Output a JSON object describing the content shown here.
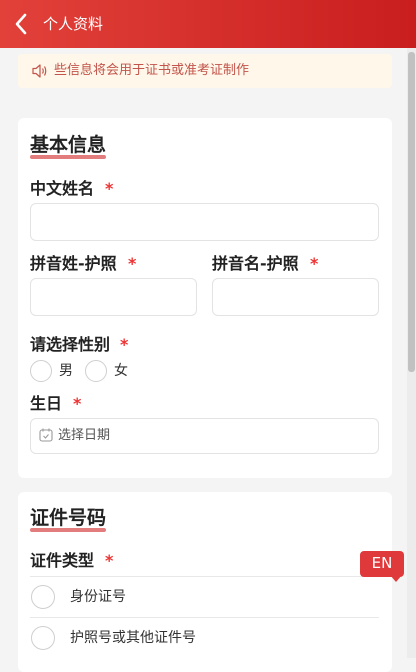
{
  "header": {
    "title": "个人资料",
    "icon": "chevron-left-icon"
  },
  "notice": {
    "icon": "speaker-icon",
    "text": "些信息将会用于证书或准考证制作"
  },
  "basic_info": {
    "title": "基本信息",
    "chinese_name": {
      "label": "中文姓名",
      "required": "*",
      "value": ""
    },
    "pinyin_surname": {
      "label": "拼音姓-护照",
      "required": "*",
      "value": ""
    },
    "pinyin_given": {
      "label": "拼音名-护照",
      "required": "*",
      "value": ""
    },
    "gender": {
      "label": "请选择性别",
      "required": "*",
      "options": [
        "男",
        "女"
      ]
    },
    "birthday": {
      "label": "生日",
      "required": "*",
      "placeholder": "选择日期",
      "icon": "calendar-icon"
    }
  },
  "id_info": {
    "title": "证件号码",
    "type_label": "证件类型",
    "required": "*",
    "options": [
      "身份证号",
      "护照号或其他证件号"
    ]
  },
  "language_badge": "EN",
  "colors": {
    "header": "#d42a2a",
    "accent": "#e0393b",
    "required": "#e33333",
    "notice_bg": "#fff7e9"
  }
}
